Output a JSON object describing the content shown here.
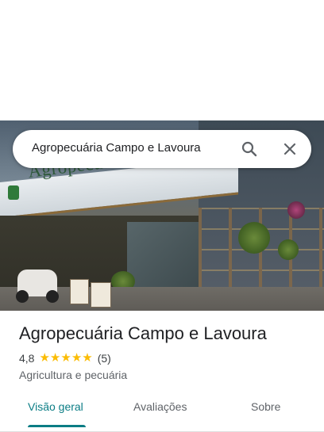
{
  "search": {
    "query": "Agropecuária Campo e Lavoura"
  },
  "photo": {
    "sign_text": "Agropecuária Campo e Lavoura"
  },
  "place": {
    "name": "Agropecuária Campo e Lavoura",
    "rating": "4,8",
    "stars": 5,
    "review_count": "(5)",
    "category": "Agricultura e pecuária"
  },
  "tabs": [
    {
      "label": "Visão geral",
      "active": true
    },
    {
      "label": "Avaliações",
      "active": false
    },
    {
      "label": "Sobre",
      "active": false
    }
  ],
  "colors": {
    "accent": "#0b7d85",
    "star": "#fbbc04"
  },
  "icons": {
    "search": "search-icon",
    "close": "close-icon",
    "star": "star-icon"
  }
}
